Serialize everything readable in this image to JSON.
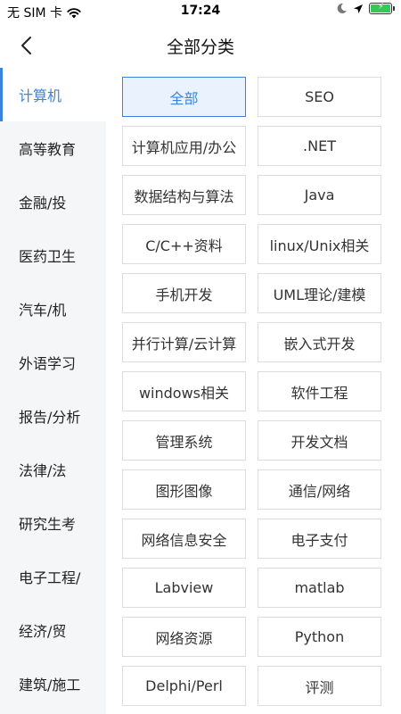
{
  "status_bar": {
    "carrier": "无 SIM 卡",
    "time": "17:24"
  },
  "header": {
    "title": "全部分类"
  },
  "sidebar": {
    "items": [
      {
        "label": "计算机",
        "active": true
      },
      {
        "label": "高等教育"
      },
      {
        "label": "金融/投"
      },
      {
        "label": "医药卫生"
      },
      {
        "label": "汽车/机"
      },
      {
        "label": "外语学习"
      },
      {
        "label": "报告/分析"
      },
      {
        "label": "法律/法"
      },
      {
        "label": "研究生考"
      },
      {
        "label": "电子工程/"
      },
      {
        "label": "经济/贸"
      },
      {
        "label": "建筑/施工"
      }
    ]
  },
  "categories": {
    "items": [
      {
        "label": "全部",
        "active": true
      },
      {
        "label": "SEO"
      },
      {
        "label": "计算机应用/办公"
      },
      {
        "label": ".NET"
      },
      {
        "label": "数据结构与算法"
      },
      {
        "label": "Java"
      },
      {
        "label": "C/C++资料"
      },
      {
        "label": "linux/Unix相关"
      },
      {
        "label": "手机开发"
      },
      {
        "label": "UML理论/建模"
      },
      {
        "label": "并行计算/云计算"
      },
      {
        "label": "嵌入式开发"
      },
      {
        "label": "windows相关"
      },
      {
        "label": "软件工程"
      },
      {
        "label": "管理系统"
      },
      {
        "label": "开发文档"
      },
      {
        "label": "图形图像"
      },
      {
        "label": "通信/网络"
      },
      {
        "label": "网络信息安全"
      },
      {
        "label": "电子支付"
      },
      {
        "label": "Labview"
      },
      {
        "label": "matlab"
      },
      {
        "label": "网络资源"
      },
      {
        "label": "Python"
      },
      {
        "label": "Delphi/Perl"
      },
      {
        "label": "评测"
      }
    ]
  },
  "colors": {
    "accent": "#3a84e0",
    "sidebar_bg": "#f5f6f8",
    "active_tag_bg": "#eaf3fd"
  }
}
